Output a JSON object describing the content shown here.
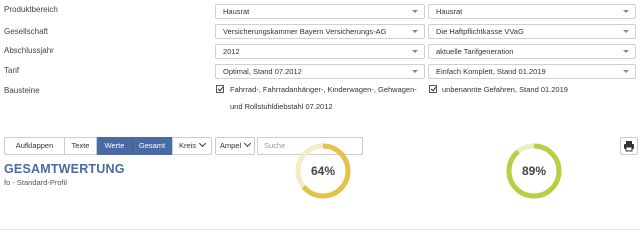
{
  "form": {
    "rows": [
      {
        "label": "Produktbereich",
        "left": "Hausrat",
        "right": "Hausrat"
      },
      {
        "label": "Gesellschaft",
        "left": "Versicherungskammer Bayern Versicherungs-AG",
        "right": "Die Haftpflichtkasse VVaG"
      },
      {
        "label": "Abschlussjahr",
        "left": "2012",
        "right": "aktuelle Tarifgeneration"
      },
      {
        "label": "Tarif",
        "left": "Optimal, Stand 07.2012",
        "right": "Einfach Komplett, Stand 01.2019"
      }
    ],
    "bausteine": {
      "label": "Bausteine",
      "left_line1": "Fahrrad-, Fahrradanhänger-, Kinderwagen-, Gehwagen-",
      "left_line2": "und Rollstuhldiebstahl 07.2012",
      "right": "unbenannte Gefahren, Stand 01.2019"
    }
  },
  "toolbar": {
    "aufklappen": "Aufklappen",
    "texte": "Texte",
    "werte": "Werte",
    "gesamt": "Gesamt",
    "kreis": "Kreis",
    "ampel": "Ampel",
    "search_placeholder": "Suche"
  },
  "result": {
    "title": "GESAMTWERTUNG",
    "profile": "fo - Standard-Profil",
    "scores": [
      {
        "value": 0.64,
        "label": "64%",
        "color": "#e2c24a",
        "track": "#f3ebc9"
      },
      {
        "value": 0.89,
        "label": "89%",
        "color": "#b6cf44",
        "track": "#e8efc4"
      }
    ]
  }
}
